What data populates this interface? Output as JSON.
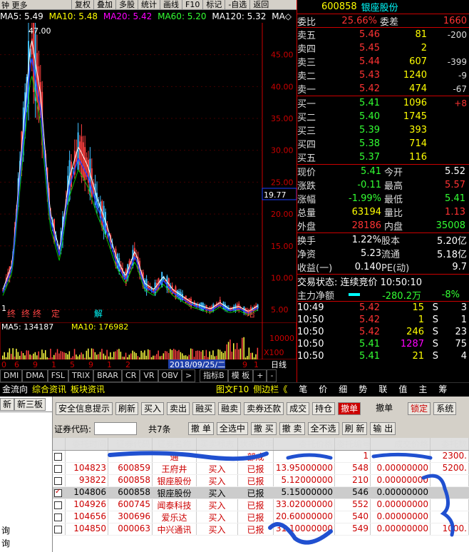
{
  "toolbar": {
    "left_label": "钟 更多",
    "buttons": [
      "复权",
      "叠加",
      "多股",
      "统计",
      "画线",
      "F10",
      "标记",
      "-自选",
      "返回"
    ]
  },
  "ma_line": {
    "ma5": "MA5: 5.49",
    "ma10": "MA10: 5.48",
    "ma20": "MA20: 5.42",
    "ma60": "MA60: 5.20",
    "ma120": "MA120: 5.32",
    "mark": "MA◇"
  },
  "chart_data": {
    "type": "candlestick",
    "y_ticks": [
      "45.00",
      "40.00",
      "35.00",
      "30.00",
      "25.00",
      "20.00",
      "15.00",
      "10.00",
      "5.00"
    ],
    "ylim": [
      3,
      50
    ],
    "peak_label": "47.00",
    "low_label": "1",
    "current_price_label": "19.77",
    "price_path": [
      8,
      12,
      30,
      47,
      38,
      20,
      14,
      25,
      30,
      27,
      22,
      18,
      13,
      10,
      14,
      9,
      8,
      10,
      8,
      7,
      6,
      5.5,
      5,
      6,
      5,
      5.4,
      4.6,
      5.5
    ],
    "volume_ticks": [
      "10000",
      "X100"
    ],
    "date_labels": [
      "0",
      "6",
      "9",
      "1",
      "5",
      "9",
      "1",
      "2",
      "2018/09/25/二",
      "9",
      "1"
    ],
    "axis_label": "日线"
  },
  "volume": {
    "text_ma5": "MA5: 134187",
    "text_ma10": "MA10: 176982"
  },
  "event_markers": [
    "终",
    "终",
    "终",
    "定",
    "解",
    "培"
  ],
  "indicator_tabs": [
    "DMI",
    "DMA",
    "FSL",
    "TRIX",
    "BRAR",
    "CR",
    "VR",
    "OBV",
    ">",
    "指标B",
    "模 板",
    "+",
    "-"
  ],
  "bottom_tabs": [
    "金流向",
    "综合资讯",
    "板块资讯",
    "图文F10",
    "侧边栏《",
    "笔",
    "价",
    "细",
    "势",
    "联",
    "值",
    "主",
    "筹"
  ],
  "quote": {
    "code": "600858",
    "name": "银座股份",
    "weibi_label": "委比",
    "weibi": "25.66%",
    "weicha_label": "委差",
    "weicha": "1660",
    "asks": [
      {
        "label": "卖五",
        "price": "5.46",
        "vol": "81",
        "chg": "-200"
      },
      {
        "label": "卖四",
        "price": "5.45",
        "vol": "2",
        "chg": ""
      },
      {
        "label": "卖三",
        "price": "5.44",
        "vol": "607",
        "chg": "-399"
      },
      {
        "label": "卖二",
        "price": "5.43",
        "vol": "1240",
        "chg": "-9"
      },
      {
        "label": "卖一",
        "price": "5.42",
        "vol": "474",
        "chg": "-67"
      }
    ],
    "bids": [
      {
        "label": "买一",
        "price": "5.41",
        "vol": "1096",
        "chg": "+8"
      },
      {
        "label": "买二",
        "price": "5.40",
        "vol": "1745",
        "chg": ""
      },
      {
        "label": "买三",
        "price": "5.39",
        "vol": "393",
        "chg": ""
      },
      {
        "label": "买四",
        "price": "5.38",
        "vol": "714",
        "chg": ""
      },
      {
        "label": "买五",
        "price": "5.37",
        "vol": "116",
        "chg": ""
      }
    ],
    "stats": [
      {
        "l1": "现价",
        "v1": "5.41",
        "l2": "今开",
        "v2": "5.52",
        "c1": "green",
        "c2": "white"
      },
      {
        "l1": "涨跌",
        "v1": "-0.11",
        "l2": "最高",
        "v2": "5.57",
        "c1": "green",
        "c2": "red"
      },
      {
        "l1": "涨幅",
        "v1": "-1.99%",
        "l2": "最低",
        "v2": "5.41",
        "c1": "green",
        "c2": "green"
      },
      {
        "l1": "总量",
        "v1": "63194",
        "l2": "量比",
        "v2": "1.13",
        "c1": "yellow",
        "c2": "red"
      },
      {
        "l1": "外盘",
        "v1": "28186",
        "l2": "内盘",
        "v2": "35008",
        "c1": "red",
        "c2": "green"
      }
    ],
    "stats2": [
      {
        "l1": "换手",
        "v1": "1.22%",
        "l2": "股本",
        "v2": "5.20亿"
      },
      {
        "l1": "净资",
        "v1": "5.23",
        "l2": "流通",
        "v2": "5.18亿"
      },
      {
        "l1": "收益(一)",
        "v1": "0.140",
        "l2": "PE(动)",
        "v2": "9.7"
      }
    ],
    "trade_status": "交易状态: 连续竞价 10:50:10",
    "main_flow_label": "主力净额",
    "main_flow": "-280.2万",
    "main_flow_pct": "-8%",
    "ticks": [
      {
        "time": "10:49",
        "price": "5.42",
        "vol": "15",
        "side": "S",
        "n": "3"
      },
      {
        "time": "10:50",
        "price": "5.42",
        "vol": "1",
        "side": "S",
        "n": "1"
      },
      {
        "time": "10:50",
        "price": "5.42",
        "vol": "246",
        "side": "S",
        "n": "23"
      },
      {
        "time": "10:50",
        "price": "5.41",
        "vol": "1287",
        "side": "S",
        "n": "75"
      },
      {
        "time": "10:50",
        "price": "5.41",
        "vol": "21",
        "side": "S",
        "n": "4"
      }
    ]
  },
  "left_nav": {
    "tabs": [
      "新",
      "新三板"
    ],
    "bottom_items": [
      "询",
      "询"
    ]
  },
  "order_toolbar": {
    "buttons": [
      "安全信息提示",
      "刷新",
      "买入",
      "卖出",
      "融买",
      "融卖",
      "卖券还款",
      "成交",
      "持仓",
      "撤单",
      "撤单",
      "锁定",
      "系统"
    ]
  },
  "order_filter": {
    "code_label": "证券代码:",
    "count": "共7条",
    "buttons": [
      "撤 单",
      "全选中",
      "撤 买",
      "撤 卖",
      "全不选",
      "刷 新",
      "输 出"
    ]
  },
  "table": {
    "headers": [
      "",
      "委托时间",
      "证券代码",
      "证券名称",
      "买卖标志",
      "状态说明",
      "委托价格",
      "委托编号",
      "成交价格",
      "委托数"
    ],
    "rows": [
      {
        "time": "",
        "code": "",
        "name": "通",
        "side": "",
        "status": "部成",
        "price": "",
        "no": "1",
        "deal": "",
        "qty": "2300.",
        "sel": false
      },
      {
        "time": "104823",
        "code": "600859",
        "name": "王府井",
        "side": "买入",
        "status": "已报",
        "price": "13.95000000",
        "no": "548",
        "deal": "0.00000000",
        "qty": "5200.",
        "sel": false
      },
      {
        "time": "93822",
        "code": "600858",
        "name": "银座股份",
        "side": "买入",
        "status": "已报",
        "price": "5.12000000",
        "no": "210",
        "deal": "0.00000000",
        "qty": "",
        "sel": false
      },
      {
        "time": "104806",
        "code": "600858",
        "name": "银座股份",
        "side": "买入",
        "status": "已报",
        "price": "5.15000000",
        "no": "546",
        "deal": "0.00000000",
        "qty": "",
        "sel": true
      },
      {
        "time": "104926",
        "code": "600745",
        "name": "闻泰科技",
        "side": "买入",
        "status": "已报",
        "price": "33.02000000",
        "no": "552",
        "deal": "0.00000000",
        "qty": "",
        "sel": false
      },
      {
        "time": "104656",
        "code": "300696",
        "name": "爱乐达",
        "side": "买入",
        "status": "已报",
        "price": "20.60000000",
        "no": "540",
        "deal": "0.00000000",
        "qty": "",
        "sel": false
      },
      {
        "time": "104850",
        "code": "000063",
        "name": "中兴通讯",
        "side": "买入",
        "status": "已报",
        "price": "31.10000000",
        "no": "549",
        "deal": "0.00000000",
        "qty": "1000.",
        "sel": false
      }
    ]
  }
}
